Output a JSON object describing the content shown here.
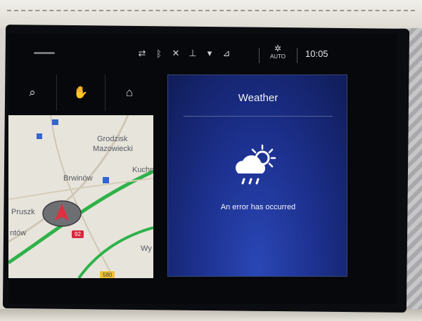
{
  "status_bar": {
    "icons": [
      "phone-link-icon",
      "bluetooth-icon",
      "mute-icon",
      "user-icon",
      "wifi-icon",
      "signal-icon"
    ],
    "climate_label": "AUTO",
    "time": "10:05"
  },
  "nav_panel": {
    "toolbar": [
      "search-icon",
      "hand-icon",
      "home-icon"
    ],
    "map": {
      "places": [
        "Grodzisk",
        "Mazowiecki",
        "Brwinów",
        "Pruszk",
        "Kuchn",
        "ntów",
        "Wy"
      ],
      "road_badges": [
        "92",
        "580"
      ]
    }
  },
  "weather": {
    "title": "Weather",
    "message": "An error has occurred",
    "icon": "partly-sunny-rain-icon"
  },
  "colors": {
    "card_top": "#101c57",
    "card_bottom": "#2a47b5",
    "route": "#2fb24a",
    "vehicle_marker": "#d7263d"
  }
}
